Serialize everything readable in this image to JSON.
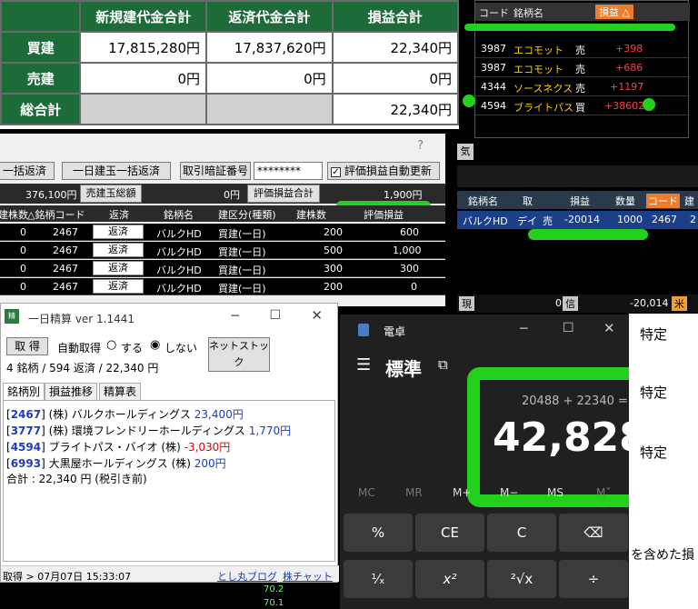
{
  "summary": {
    "headers": [
      "新規建代金合計",
      "返済代金合計",
      "損益合計"
    ],
    "rows": [
      {
        "label": "買建",
        "values": [
          "17,815,280円",
          "17,837,620円",
          "22,340円"
        ]
      },
      {
        "label": "売建",
        "values": [
          "0円",
          "0円",
          "0円"
        ]
      },
      {
        "label": "総合計",
        "values": [
          "",
          "",
          "22,340円"
        ]
      }
    ]
  },
  "stocklist": {
    "headers": {
      "code": "コード",
      "name": "銘柄名",
      "side": "",
      "pl": "損益 △"
    },
    "rows": [
      {
        "code": "3987",
        "name": "エコモット",
        "side": "売",
        "pl": "+398"
      },
      {
        "code": "3987",
        "name": "エコモット",
        "side": "売",
        "pl": "+686"
      },
      {
        "code": "4344",
        "name": "ソースネクス",
        "side": "売",
        "pl": "+1197"
      },
      {
        "code": "4594",
        "name": "ブライトパス",
        "side": "買",
        "pl": "+38602"
      }
    ]
  },
  "mainwin": {
    "buttons": {
      "bulk": "一括返済",
      "day_bulk": "一日建玉一括返済",
      "pin_label": "取引暗証番号",
      "pin_value": "********",
      "auto": "評価損益自動更新"
    },
    "amount": "376,100円",
    "short_total_btn": "売建玉総額",
    "short_total": "0円",
    "eval_btn": "評価損益合計",
    "eval_total": "1,900円",
    "grid_headers": [
      "建株数",
      "△銘柄コード",
      "返済",
      "銘柄名",
      "建区分(種類)",
      "建株数",
      "評価損益"
    ],
    "rows": [
      {
        "a": "0",
        "code": "2467",
        "btn": "返済",
        "name": "バルクHD",
        "type": "買建(一日)",
        "qty": "200",
        "pl": "600"
      },
      {
        "a": "0",
        "code": "2467",
        "btn": "返済",
        "name": "バルクHD",
        "type": "買建(一日)",
        "qty": "500",
        "pl": "1,000"
      },
      {
        "a": "0",
        "code": "2467",
        "btn": "返済",
        "name": "バルクHD",
        "type": "買建(一日)",
        "qty": "300",
        "pl": "300"
      },
      {
        "a": "0",
        "code": "2467",
        "btn": "返済",
        "name": "バルクHD",
        "type": "買建(一日)",
        "qty": "200",
        "pl": "0"
      }
    ]
  },
  "board": {
    "tag": "気",
    "headers": {
      "name": "銘柄名",
      "side": "取",
      "pl": "損益",
      "qty": "数量",
      "code": "コード",
      "extra": "建"
    },
    "row": {
      "name": "バルクHD",
      "kind": "デイ",
      "side": "売",
      "pl": "-20014",
      "qty": "1000",
      "code": "2467",
      "extra": "2"
    },
    "footer": {
      "a": "現",
      "b": "0",
      "c": "信",
      "d": "-20,014",
      "e": "米"
    }
  },
  "seisan": {
    "title": "一日精算 ver 1.1441",
    "fetch_btn": "取 得",
    "auto_label": "自動取得",
    "on_label": "する",
    "off_label": "しない",
    "net_btn": "ネットストック",
    "status": "4 銘柄 / 594 返済 / 22,340 円",
    "tabs": [
      "銘柄別",
      "損益推移",
      "精算表"
    ],
    "items": [
      {
        "code": "2467",
        "name": "(株) バルクホールディングス",
        "value": "23,400円",
        "neg": false
      },
      {
        "code": "3777",
        "name": "(株) 環境フレンドリーホールディングス",
        "value": "1,770円",
        "neg": false
      },
      {
        "code": "4594",
        "name": "ブライトパス・バイオ (株)",
        "value": "-3,030円",
        "neg": true
      },
      {
        "code": "6993",
        "name": "大黒屋ホールディングス (株)",
        "value": "200円",
        "neg": false
      }
    ],
    "total": "合計 : 22,340 円 (税引き前)",
    "footer": "取得 > 07月07日 15:33:07",
    "link1": "とし丸ブログ",
    "link2": "株チャット",
    "bottom_values": [
      "70.2",
      "70.1"
    ]
  },
  "calc": {
    "title": "電卓",
    "mode": "標準",
    "expression": "20488 + 22340 =",
    "result": "42,828",
    "memory": [
      "MC",
      "MR",
      "M+",
      "M−",
      "MS",
      "M˅"
    ],
    "keys": [
      "%",
      "CE",
      "C",
      "⌫",
      "¹⁄ₓ",
      "x²",
      "²√x",
      "÷"
    ]
  },
  "right_panel": {
    "items": [
      "特定",
      "特定",
      "特定"
    ],
    "note": "を含めた損"
  },
  "colors": {
    "highlight": "#23d11c",
    "header_green": "#1e6b3a"
  }
}
